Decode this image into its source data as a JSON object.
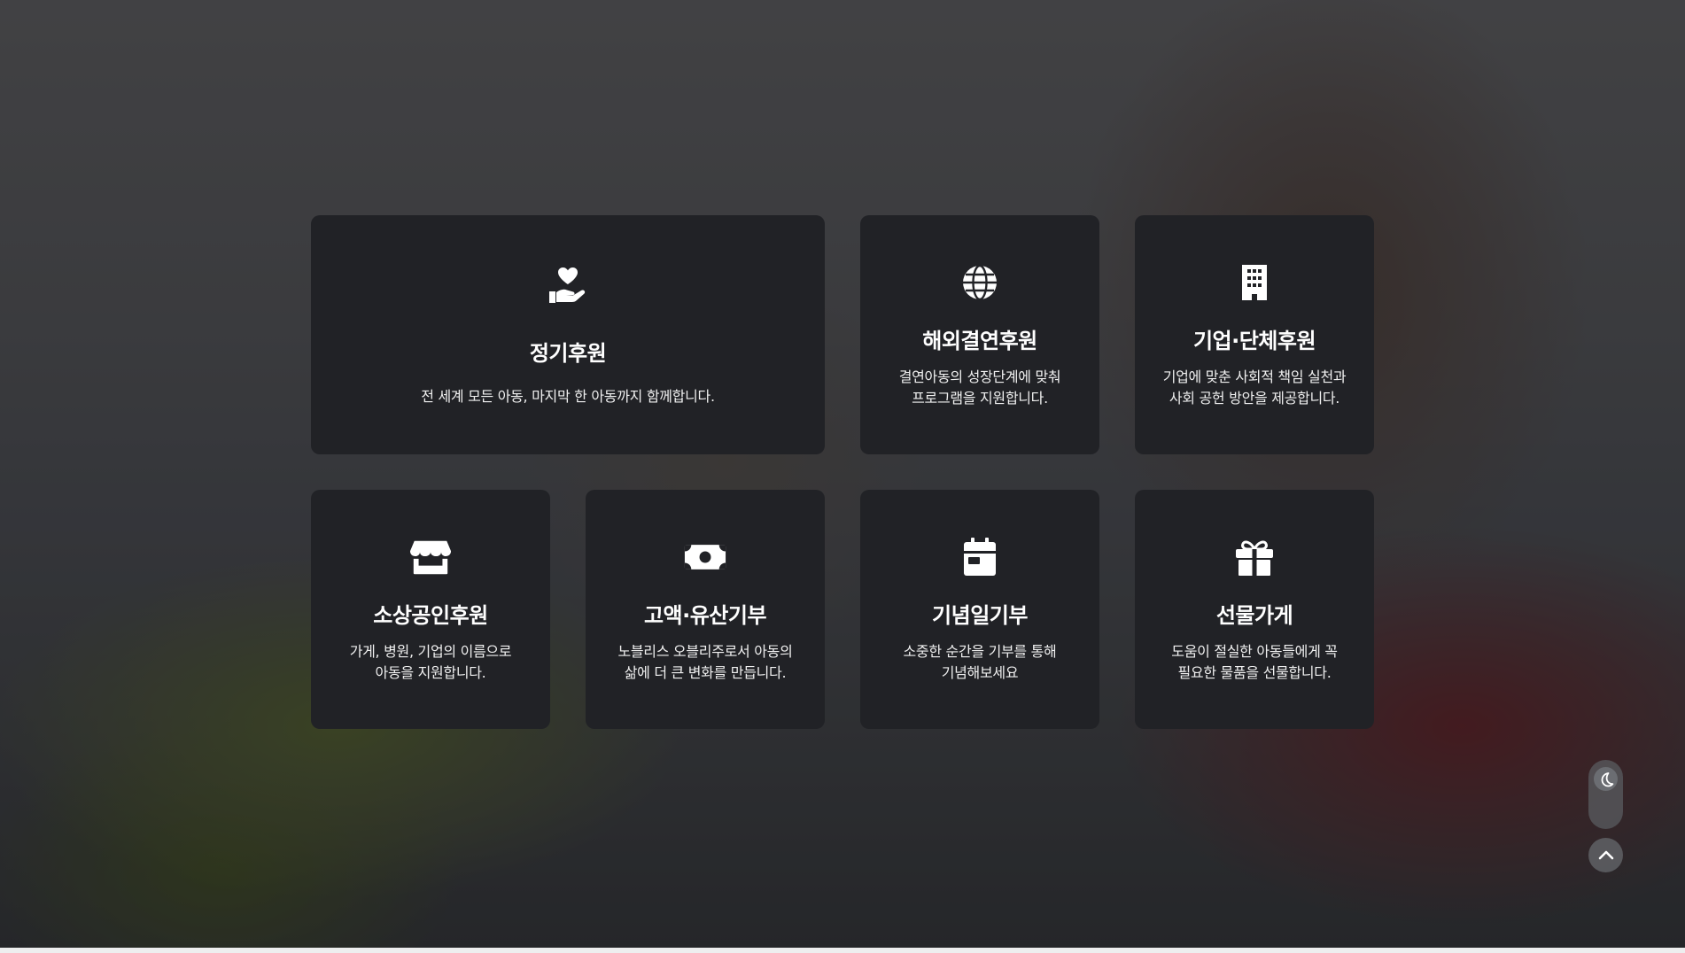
{
  "cards": [
    {
      "icon": "hand-heart-icon",
      "title": "정기후원",
      "desc": [
        "전 세계 모든 아동, 마지막 한 아동까지 함께합니다."
      ]
    },
    {
      "icon": "globe-icon",
      "title": "해외결연후원",
      "desc": [
        "결연아동의 성장단계에 맞춰",
        "프로그램을 지원합니다."
      ]
    },
    {
      "icon": "building-icon",
      "title": "기업·단체후원",
      "desc": [
        "기업에 맞춘 사회적 책임 실천과",
        "사회 공헌 방안을 제공합니다."
      ]
    },
    {
      "icon": "store-icon",
      "title": "소상공인후원",
      "desc": [
        "가게, 병원, 기업의 이름으로",
        "아동을 지원합니다."
      ]
    },
    {
      "icon": "money-bill-icon",
      "title": "고액·유산기부",
      "desc": [
        "노블리스 오블리주로서 아동의",
        "삶에 더 큰 변화를 만듭니다."
      ]
    },
    {
      "icon": "calendar-icon",
      "title": "기념일기부",
      "desc": [
        "소중한 순간을 기부를 통해",
        "기념해보세요"
      ]
    },
    {
      "icon": "gift-icon",
      "title": "선물가게",
      "desc": [
        "도움이 절실한 아동들에게 꼭",
        "필요한 물품을 선물합니다."
      ]
    }
  ],
  "colors": {
    "card_bg": "#212226",
    "text": "#ffffff"
  }
}
